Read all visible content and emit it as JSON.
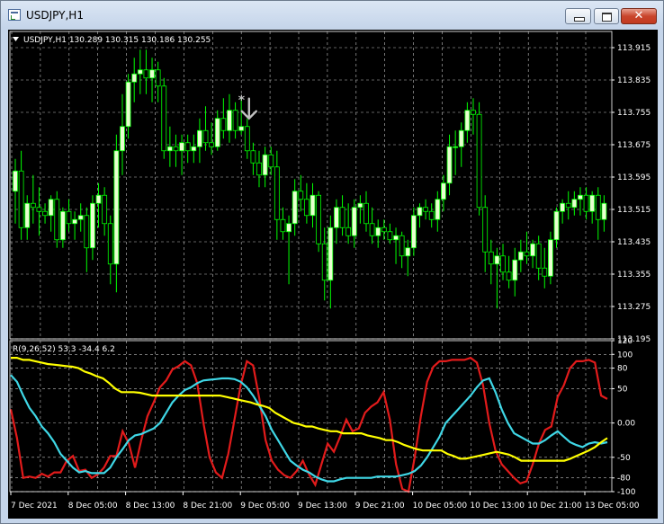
{
  "window": {
    "title": "USDJPY,H1",
    "close_glyph": "✕",
    "icons": [
      "chart-window-icon",
      "minimize-icon",
      "maximize-icon",
      "close-icon"
    ]
  },
  "chart_header": {
    "label": "USDJPY,H1  130.289 130.315 130.186 130.255",
    "menu_icon": "triangle-down-icon"
  },
  "price_axis": {
    "labels": [
      "113.915",
      "113.835",
      "113.755",
      "113.675",
      "113.595",
      "113.515",
      "113.435",
      "113.355",
      "113.275",
      "113.195"
    ]
  },
  "indicator": {
    "label": "R(9,26,52) 53.3 -34.4 6.2",
    "axis_labels": [
      "120",
      "100",
      "80",
      "50",
      "0.00",
      "-50",
      "-80",
      "-100"
    ]
  },
  "time_axis": {
    "labels": [
      "7 Dec 2021",
      "8 Dec 05:00",
      "8 Dec 13:00",
      "8 Dec 21:00",
      "9 Dec 05:00",
      "9 Dec 13:00",
      "9 Dec 21:00",
      "10 Dec 05:00",
      "10 Dec 13:00",
      "10 Dec 21:00",
      "13 Dec 05:00"
    ]
  },
  "colors": {
    "background": "#000000",
    "bull_candle": "#e8ffd0",
    "bear_candle": "#000000",
    "wick": "#00ff00",
    "grid": "#c0c0c0",
    "axis_text": "#ffffff",
    "red_line": "#e21b1b",
    "cyan_line": "#3fd7e6",
    "yellow_line": "#ffff00",
    "signal_arrow": "#c0c0c0"
  },
  "signal": {
    "type": "sell-arrow",
    "icon": "down-arrow-icon",
    "star_icon": "star-icon",
    "candle_index": 39
  },
  "chart_data": [
    {
      "type": "candlestick",
      "title": "USDJPY,H1",
      "ylim": [
        113.195,
        113.955
      ],
      "y_ticks": [
        113.915,
        113.835,
        113.755,
        113.675,
        113.595,
        113.515,
        113.435,
        113.355,
        113.275,
        113.195
      ],
      "x_labels": [
        "7 Dec 2021",
        "8 Dec 05:00",
        "8 Dec 13:00",
        "8 Dec 21:00",
        "9 Dec 05:00",
        "9 Dec 13:00",
        "9 Dec 21:00",
        "10 Dec 05:00",
        "10 Dec 13:00",
        "10 Dec 21:00",
        "13 Dec 05:00"
      ],
      "grid": true,
      "candles": [
        {
          "o": 113.56,
          "h": 113.64,
          "l": 113.48,
          "c": 113.61
        },
        {
          "o": 113.61,
          "h": 113.66,
          "l": 113.44,
          "c": 113.47
        },
        {
          "o": 113.47,
          "h": 113.55,
          "l": 113.44,
          "c": 113.53
        },
        {
          "o": 113.53,
          "h": 113.6,
          "l": 113.48,
          "c": 113.52
        },
        {
          "o": 113.52,
          "h": 113.57,
          "l": 113.45,
          "c": 113.51
        },
        {
          "o": 113.51,
          "h": 113.53,
          "l": 113.48,
          "c": 113.5
        },
        {
          "o": 113.5,
          "h": 113.55,
          "l": 113.46,
          "c": 113.54
        },
        {
          "o": 113.54,
          "h": 113.56,
          "l": 113.42,
          "c": 113.44
        },
        {
          "o": 113.44,
          "h": 113.52,
          "l": 113.42,
          "c": 113.51
        },
        {
          "o": 113.51,
          "h": 113.54,
          "l": 113.46,
          "c": 113.48
        },
        {
          "o": 113.48,
          "h": 113.51,
          "l": 113.44,
          "c": 113.49
        },
        {
          "o": 113.49,
          "h": 113.53,
          "l": 113.46,
          "c": 113.5
        },
        {
          "o": 113.5,
          "h": 113.52,
          "l": 113.36,
          "c": 113.42
        },
        {
          "o": 113.42,
          "h": 113.55,
          "l": 113.39,
          "c": 113.53
        },
        {
          "o": 113.53,
          "h": 113.58,
          "l": 113.47,
          "c": 113.55
        },
        {
          "o": 113.55,
          "h": 113.57,
          "l": 113.45,
          "c": 113.48
        },
        {
          "o": 113.48,
          "h": 113.5,
          "l": 113.33,
          "c": 113.38
        },
        {
          "o": 113.38,
          "h": 113.7,
          "l": 113.31,
          "c": 113.66
        },
        {
          "o": 113.66,
          "h": 113.8,
          "l": 113.6,
          "c": 113.72
        },
        {
          "o": 113.72,
          "h": 113.85,
          "l": 113.69,
          "c": 113.83
        },
        {
          "o": 113.83,
          "h": 113.89,
          "l": 113.78,
          "c": 113.85
        },
        {
          "o": 113.85,
          "h": 113.91,
          "l": 113.8,
          "c": 113.86
        },
        {
          "o": 113.86,
          "h": 113.91,
          "l": 113.8,
          "c": 113.84
        },
        {
          "o": 113.84,
          "h": 113.89,
          "l": 113.78,
          "c": 113.86
        },
        {
          "o": 113.86,
          "h": 113.88,
          "l": 113.78,
          "c": 113.82
        },
        {
          "o": 113.82,
          "h": 113.84,
          "l": 113.64,
          "c": 113.66
        },
        {
          "o": 113.66,
          "h": 113.72,
          "l": 113.62,
          "c": 113.67
        },
        {
          "o": 113.67,
          "h": 113.7,
          "l": 113.62,
          "c": 113.66
        },
        {
          "o": 113.66,
          "h": 113.7,
          "l": 113.6,
          "c": 113.68
        },
        {
          "o": 113.68,
          "h": 113.7,
          "l": 113.63,
          "c": 113.66
        },
        {
          "o": 113.66,
          "h": 113.7,
          "l": 113.63,
          "c": 113.67
        },
        {
          "o": 113.67,
          "h": 113.74,
          "l": 113.63,
          "c": 113.71
        },
        {
          "o": 113.71,
          "h": 113.77,
          "l": 113.66,
          "c": 113.68
        },
        {
          "o": 113.68,
          "h": 113.73,
          "l": 113.65,
          "c": 113.67
        },
        {
          "o": 113.67,
          "h": 113.76,
          "l": 113.66,
          "c": 113.74
        },
        {
          "o": 113.74,
          "h": 113.79,
          "l": 113.69,
          "c": 113.71
        },
        {
          "o": 113.71,
          "h": 113.8,
          "l": 113.68,
          "c": 113.76
        },
        {
          "o": 113.76,
          "h": 113.78,
          "l": 113.69,
          "c": 113.71
        },
        {
          "o": 113.71,
          "h": 113.79,
          "l": 113.7,
          "c": 113.72
        },
        {
          "o": 113.72,
          "h": 113.74,
          "l": 113.64,
          "c": 113.66
        },
        {
          "o": 113.66,
          "h": 113.68,
          "l": 113.6,
          "c": 113.63
        },
        {
          "o": 113.63,
          "h": 113.66,
          "l": 113.57,
          "c": 113.6
        },
        {
          "o": 113.6,
          "h": 113.67,
          "l": 113.57,
          "c": 113.65
        },
        {
          "o": 113.65,
          "h": 113.67,
          "l": 113.6,
          "c": 113.62
        },
        {
          "o": 113.62,
          "h": 113.66,
          "l": 113.44,
          "c": 113.49
        },
        {
          "o": 113.49,
          "h": 113.52,
          "l": 113.44,
          "c": 113.46
        },
        {
          "o": 113.46,
          "h": 113.5,
          "l": 113.33,
          "c": 113.48
        },
        {
          "o": 113.48,
          "h": 113.59,
          "l": 113.45,
          "c": 113.56
        },
        {
          "o": 113.56,
          "h": 113.6,
          "l": 113.51,
          "c": 113.54
        },
        {
          "o": 113.54,
          "h": 113.58,
          "l": 113.48,
          "c": 113.5
        },
        {
          "o": 113.5,
          "h": 113.58,
          "l": 113.47,
          "c": 113.55
        },
        {
          "o": 113.55,
          "h": 113.56,
          "l": 113.41,
          "c": 113.43
        },
        {
          "o": 113.43,
          "h": 113.47,
          "l": 113.29,
          "c": 113.34
        },
        {
          "o": 113.34,
          "h": 113.5,
          "l": 113.27,
          "c": 113.47
        },
        {
          "o": 113.47,
          "h": 113.54,
          "l": 113.43,
          "c": 113.52
        },
        {
          "o": 113.52,
          "h": 113.55,
          "l": 113.45,
          "c": 113.47
        },
        {
          "o": 113.47,
          "h": 113.53,
          "l": 113.43,
          "c": 113.45
        },
        {
          "o": 113.45,
          "h": 113.54,
          "l": 113.42,
          "c": 113.52
        },
        {
          "o": 113.52,
          "h": 113.55,
          "l": 113.48,
          "c": 113.53
        },
        {
          "o": 113.53,
          "h": 113.56,
          "l": 113.46,
          "c": 113.48
        },
        {
          "o": 113.48,
          "h": 113.52,
          "l": 113.43,
          "c": 113.45
        },
        {
          "o": 113.45,
          "h": 113.49,
          "l": 113.42,
          "c": 113.47
        },
        {
          "o": 113.47,
          "h": 113.49,
          "l": 113.44,
          "c": 113.46
        },
        {
          "o": 113.46,
          "h": 113.48,
          "l": 113.43,
          "c": 113.44
        },
        {
          "o": 113.44,
          "h": 113.47,
          "l": 113.38,
          "c": 113.45
        },
        {
          "o": 113.45,
          "h": 113.46,
          "l": 113.37,
          "c": 113.4
        },
        {
          "o": 113.4,
          "h": 113.44,
          "l": 113.35,
          "c": 113.42
        },
        {
          "o": 113.42,
          "h": 113.52,
          "l": 113.4,
          "c": 113.5
        },
        {
          "o": 113.5,
          "h": 113.53,
          "l": 113.47,
          "c": 113.52
        },
        {
          "o": 113.52,
          "h": 113.54,
          "l": 113.49,
          "c": 113.51
        },
        {
          "o": 113.51,
          "h": 113.53,
          "l": 113.47,
          "c": 113.49
        },
        {
          "o": 113.49,
          "h": 113.56,
          "l": 113.46,
          "c": 113.54
        },
        {
          "o": 113.54,
          "h": 113.6,
          "l": 113.51,
          "c": 113.58
        },
        {
          "o": 113.58,
          "h": 113.7,
          "l": 113.55,
          "c": 113.67
        },
        {
          "o": 113.67,
          "h": 113.71,
          "l": 113.6,
          "c": 113.67
        },
        {
          "o": 113.67,
          "h": 113.73,
          "l": 113.62,
          "c": 113.71
        },
        {
          "o": 113.71,
          "h": 113.78,
          "l": 113.68,
          "c": 113.76
        },
        {
          "o": 113.76,
          "h": 113.79,
          "l": 113.7,
          "c": 113.75
        },
        {
          "o": 113.75,
          "h": 113.78,
          "l": 113.5,
          "c": 113.52
        },
        {
          "o": 113.52,
          "h": 113.55,
          "l": 113.36,
          "c": 113.41
        },
        {
          "o": 113.41,
          "h": 113.44,
          "l": 113.33,
          "c": 113.38
        },
        {
          "o": 113.38,
          "h": 113.42,
          "l": 113.27,
          "c": 113.4
        },
        {
          "o": 113.4,
          "h": 113.43,
          "l": 113.34,
          "c": 113.36
        },
        {
          "o": 113.36,
          "h": 113.4,
          "l": 113.32,
          "c": 113.34
        },
        {
          "o": 113.34,
          "h": 113.42,
          "l": 113.3,
          "c": 113.39
        },
        {
          "o": 113.39,
          "h": 113.44,
          "l": 113.36,
          "c": 113.41
        },
        {
          "o": 113.41,
          "h": 113.46,
          "l": 113.38,
          "c": 113.4
        },
        {
          "o": 113.4,
          "h": 113.44,
          "l": 113.37,
          "c": 113.43
        },
        {
          "o": 113.43,
          "h": 113.45,
          "l": 113.34,
          "c": 113.37
        },
        {
          "o": 113.37,
          "h": 113.42,
          "l": 113.32,
          "c": 113.35
        },
        {
          "o": 113.35,
          "h": 113.46,
          "l": 113.33,
          "c": 113.44
        },
        {
          "o": 113.44,
          "h": 113.52,
          "l": 113.42,
          "c": 113.51
        },
        {
          "o": 113.51,
          "h": 113.54,
          "l": 113.48,
          "c": 113.53
        },
        {
          "o": 113.53,
          "h": 113.56,
          "l": 113.49,
          "c": 113.52
        },
        {
          "o": 113.52,
          "h": 113.56,
          "l": 113.5,
          "c": 113.54
        },
        {
          "o": 113.54,
          "h": 113.57,
          "l": 113.5,
          "c": 113.55
        },
        {
          "o": 113.55,
          "h": 113.57,
          "l": 113.49,
          "c": 113.51
        },
        {
          "o": 113.51,
          "h": 113.56,
          "l": 113.48,
          "c": 113.55
        },
        {
          "o": 113.55,
          "h": 113.57,
          "l": 113.44,
          "c": 113.49
        },
        {
          "o": 113.49,
          "h": 113.55,
          "l": 113.46,
          "c": 113.53
        }
      ]
    },
    {
      "type": "line",
      "title": "R(9,26,52)",
      "ylim": [
        -100,
        120
      ],
      "y_ticks": [
        100,
        80,
        50,
        0,
        -50,
        -80,
        -100
      ],
      "grid": true,
      "series": [
        {
          "name": "9",
          "values": [
            20,
            -22,
            -80,
            -78,
            -80,
            -74,
            -78,
            -72,
            -72,
            -55,
            -48,
            -70,
            -68,
            -80,
            -75,
            -65,
            -48,
            -48,
            -12,
            -30,
            -65,
            -25,
            10,
            30,
            52,
            62,
            78,
            83,
            90,
            84,
            58,
            0,
            -50,
            -72,
            -80,
            -45,
            5,
            55,
            90,
            84,
            35,
            -25,
            -55,
            -68,
            -76,
            -80,
            -70,
            -55,
            -75,
            -90,
            -60,
            -30,
            -42,
            -20,
            5,
            -12,
            -8,
            15,
            24,
            30,
            45,
            5,
            -60,
            -96,
            -100,
            -50,
            10,
            60,
            82,
            90,
            90,
            92,
            92,
            92,
            95,
            88,
            55,
            0,
            -40,
            -60,
            -70,
            -80,
            -88,
            -85,
            -60,
            -30,
            -10,
            -5,
            38,
            55,
            80,
            90,
            90,
            92,
            88,
            40,
            35
          ]
        },
        {
          "name": "26",
          "values": [
            70,
            60,
            40,
            22,
            10,
            -5,
            -15,
            -28,
            -45,
            -55,
            -65,
            -72,
            -70,
            -73,
            -73,
            -73,
            -65,
            -50,
            -38,
            -25,
            -18,
            -16,
            -12,
            -8,
            0,
            15,
            30,
            40,
            48,
            52,
            58,
            62,
            63,
            64,
            65,
            65,
            64,
            60,
            52,
            40,
            25,
            10,
            -10,
            -25,
            -40,
            -55,
            -62,
            -68,
            -72,
            -78,
            -82,
            -85,
            -85,
            -82,
            -80,
            -80,
            -80,
            -80,
            -80,
            -78,
            -78,
            -78,
            -78,
            -76,
            -74,
            -70,
            -62,
            -50,
            -35,
            -20,
            0,
            10,
            20,
            30,
            40,
            52,
            62,
            65,
            45,
            20,
            0,
            -15,
            -20,
            -25,
            -30,
            -30,
            -25,
            -18,
            -12,
            -20,
            -28,
            -32,
            -35,
            -30,
            -28,
            -30,
            -28
          ]
        },
        {
          "name": "52",
          "values": [
            95,
            95,
            92,
            92,
            90,
            88,
            86,
            85,
            84,
            83,
            82,
            80,
            75,
            72,
            68,
            65,
            58,
            50,
            45,
            45,
            45,
            44,
            42,
            40,
            40,
            40,
            40,
            40,
            40,
            40,
            40,
            40,
            40,
            40,
            40,
            38,
            36,
            34,
            32,
            30,
            27,
            25,
            22,
            15,
            10,
            5,
            0,
            -2,
            -5,
            -5,
            -8,
            -10,
            -12,
            -12,
            -15,
            -15,
            -15,
            -15,
            -18,
            -20,
            -22,
            -25,
            -25,
            -28,
            -32,
            -35,
            -38,
            -40,
            -40,
            -40,
            -40,
            -45,
            -48,
            -52,
            -52,
            -50,
            -48,
            -46,
            -44,
            -42,
            -44,
            -46,
            -50,
            -55,
            -55,
            -55,
            -55,
            -55,
            -55,
            -55,
            -55,
            -52,
            -48,
            -44,
            -40,
            -35,
            -28,
            -22
          ]
        }
      ]
    }
  ]
}
